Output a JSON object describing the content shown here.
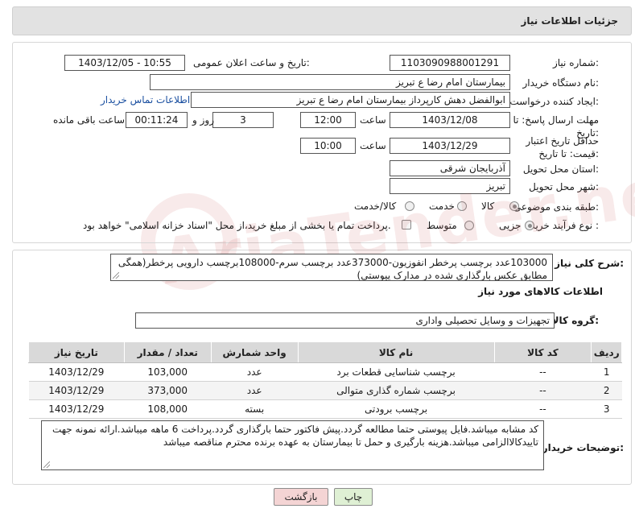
{
  "header": {
    "title": "جزئیات اطلاعات نیاز"
  },
  "form": {
    "need_number": {
      "label": "شماره نیاز:",
      "value": "1103090988001291"
    },
    "announce_datetime": {
      "label": "تاریخ و ساعت اعلان عمومی:",
      "value": "1403/12/05 - 10:55"
    },
    "buyer_org": {
      "label": "نام دستگاه خریدار:",
      "value": "بیمارستان امام رضا  ع  تبریز"
    },
    "requester": {
      "label": "ایجاد کننده درخواست:",
      "value": "ابوالفضل دهش کارپرداز بیمارستان امام رضا  ع  تبریز",
      "contact_link": "اطلاعات تماس خریدار"
    },
    "reply_deadline": {
      "label": "مهلت ارسال پاسخ: تا تاریخ:",
      "date": "1403/12/08",
      "time_label": "ساعت",
      "time": "12:00",
      "days": "3",
      "days_label": "روز و",
      "remaining": "00:11:24",
      "remaining_label": "ساعت باقی مانده"
    },
    "price_validity": {
      "label": "حداقل تاریخ اعتبار قیمت: تا تاریخ:",
      "date": "1403/12/29",
      "time_label": "ساعت",
      "time": "10:00"
    },
    "delivery_province": {
      "label": "استان محل تحویل:",
      "value": "آذربایجان شرقی"
    },
    "delivery_city": {
      "label": "شهر محل تحویل:",
      "value": "تبریز"
    },
    "category": {
      "label": "طبقه بندی موضوعی:",
      "options": [
        "کالا",
        "خدمت",
        "کالا/خدمت"
      ]
    },
    "purchase_type": {
      "label": "نوع فرآیند خرید :",
      "options": [
        "جزیی",
        "متوسط"
      ],
      "payment_note": "پرداخت تمام یا بخشی از مبلغ خرید،از محل \"اسناد خزانه اسلامی\" خواهد بود."
    }
  },
  "description": {
    "label": "شرح کلی نیاز:",
    "text": "103000عدد برچسب پرخطر انفوزیون-373000عدد برچسب سرم-108000برچسب دارویی پرخطر(همگی مطابق عکس بارگذاری شده در مدارک پیوستی)"
  },
  "goods_info": {
    "title": "اطلاعات کالاهای مورد نیاز"
  },
  "goods_group": {
    "label": "گروه کالا:",
    "value": "تجهیزات و وسایل تحصیلی واداری"
  },
  "table": {
    "headers": [
      "ردیف",
      "کد کالا",
      "نام کالا",
      "واحد شمارش",
      "تعداد / مقدار",
      "تاریخ نیاز"
    ],
    "rows": [
      {
        "row": "1",
        "code": "--",
        "name": "برچسب شناسایی قطعات برد",
        "unit": "عدد",
        "qty": "103,000",
        "date": "1403/12/29"
      },
      {
        "row": "2",
        "code": "--",
        "name": "برچسب شماره گذاری متوالی",
        "unit": "عدد",
        "qty": "373,000",
        "date": "1403/12/29"
      },
      {
        "row": "3",
        "code": "--",
        "name": "برچسب برودتی",
        "unit": "بسته",
        "qty": "108,000",
        "date": "1403/12/29"
      }
    ]
  },
  "buyer_notes": {
    "label": "توضیحات خریدار:",
    "text": "کد مشابه میباشد.فایل پیوستی حتما مطالعه گردد.پیش فاکتور حتما بارگذاری گردد.پرداخت 6 ماهه میباشد.ارائه نمونه جهت تاییدکالاالزامی میباشد.هزینه بارگیری و حمل تا بیمارستان به عهده برنده محترم مناقصه میباشد"
  },
  "buttons": {
    "print": "چاپ",
    "back": "بازگشت"
  },
  "colors": {
    "back_button_bg": "#f4d4d4",
    "print_button_bg": "#dff0d4",
    "link": "#1a4fa0"
  }
}
